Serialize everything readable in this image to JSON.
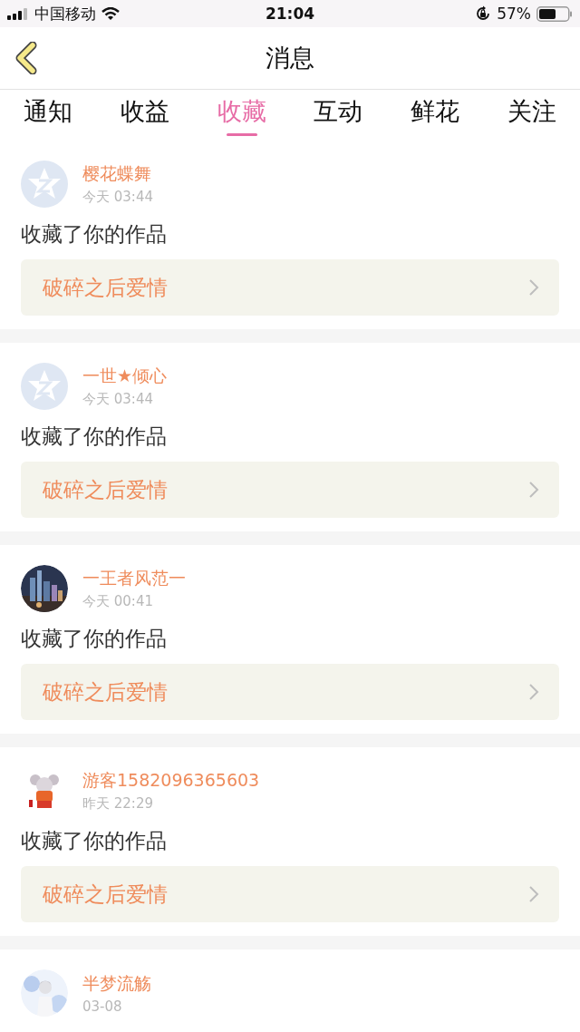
{
  "status_bar": {
    "carrier": "中国移动",
    "time": "21:04",
    "battery": "57%"
  },
  "nav": {
    "title": "消息"
  },
  "tabs": [
    {
      "label": "通知",
      "selected": false
    },
    {
      "label": "收益",
      "selected": false
    },
    {
      "label": "收藏",
      "selected": true
    },
    {
      "label": "互动",
      "selected": false
    },
    {
      "label": "鲜花",
      "selected": false
    },
    {
      "label": "关注",
      "selected": false
    }
  ],
  "messages": [
    {
      "avatar": {
        "kind": "default"
      },
      "name": "樱花蝶舞",
      "time": "今天 03:44",
      "text": "收藏了你的作品",
      "work": "破碎之后爱情"
    },
    {
      "avatar": {
        "kind": "default"
      },
      "name": "一世★倾心",
      "time": "今天 03:44",
      "text": "收藏了你的作品",
      "work": "破碎之后爱情"
    },
    {
      "name": "一王者风范一",
      "time": "今天 00:41",
      "text": "收藏了你的作品",
      "work": "破碎之后爱情"
    },
    {
      "name": "游客1582096365603",
      "time": "昨天 22:29",
      "text": "收藏了你的作品",
      "work": "破碎之后爱情"
    },
    {
      "name": "半梦流觞",
      "time": "03-08"
    }
  ]
}
